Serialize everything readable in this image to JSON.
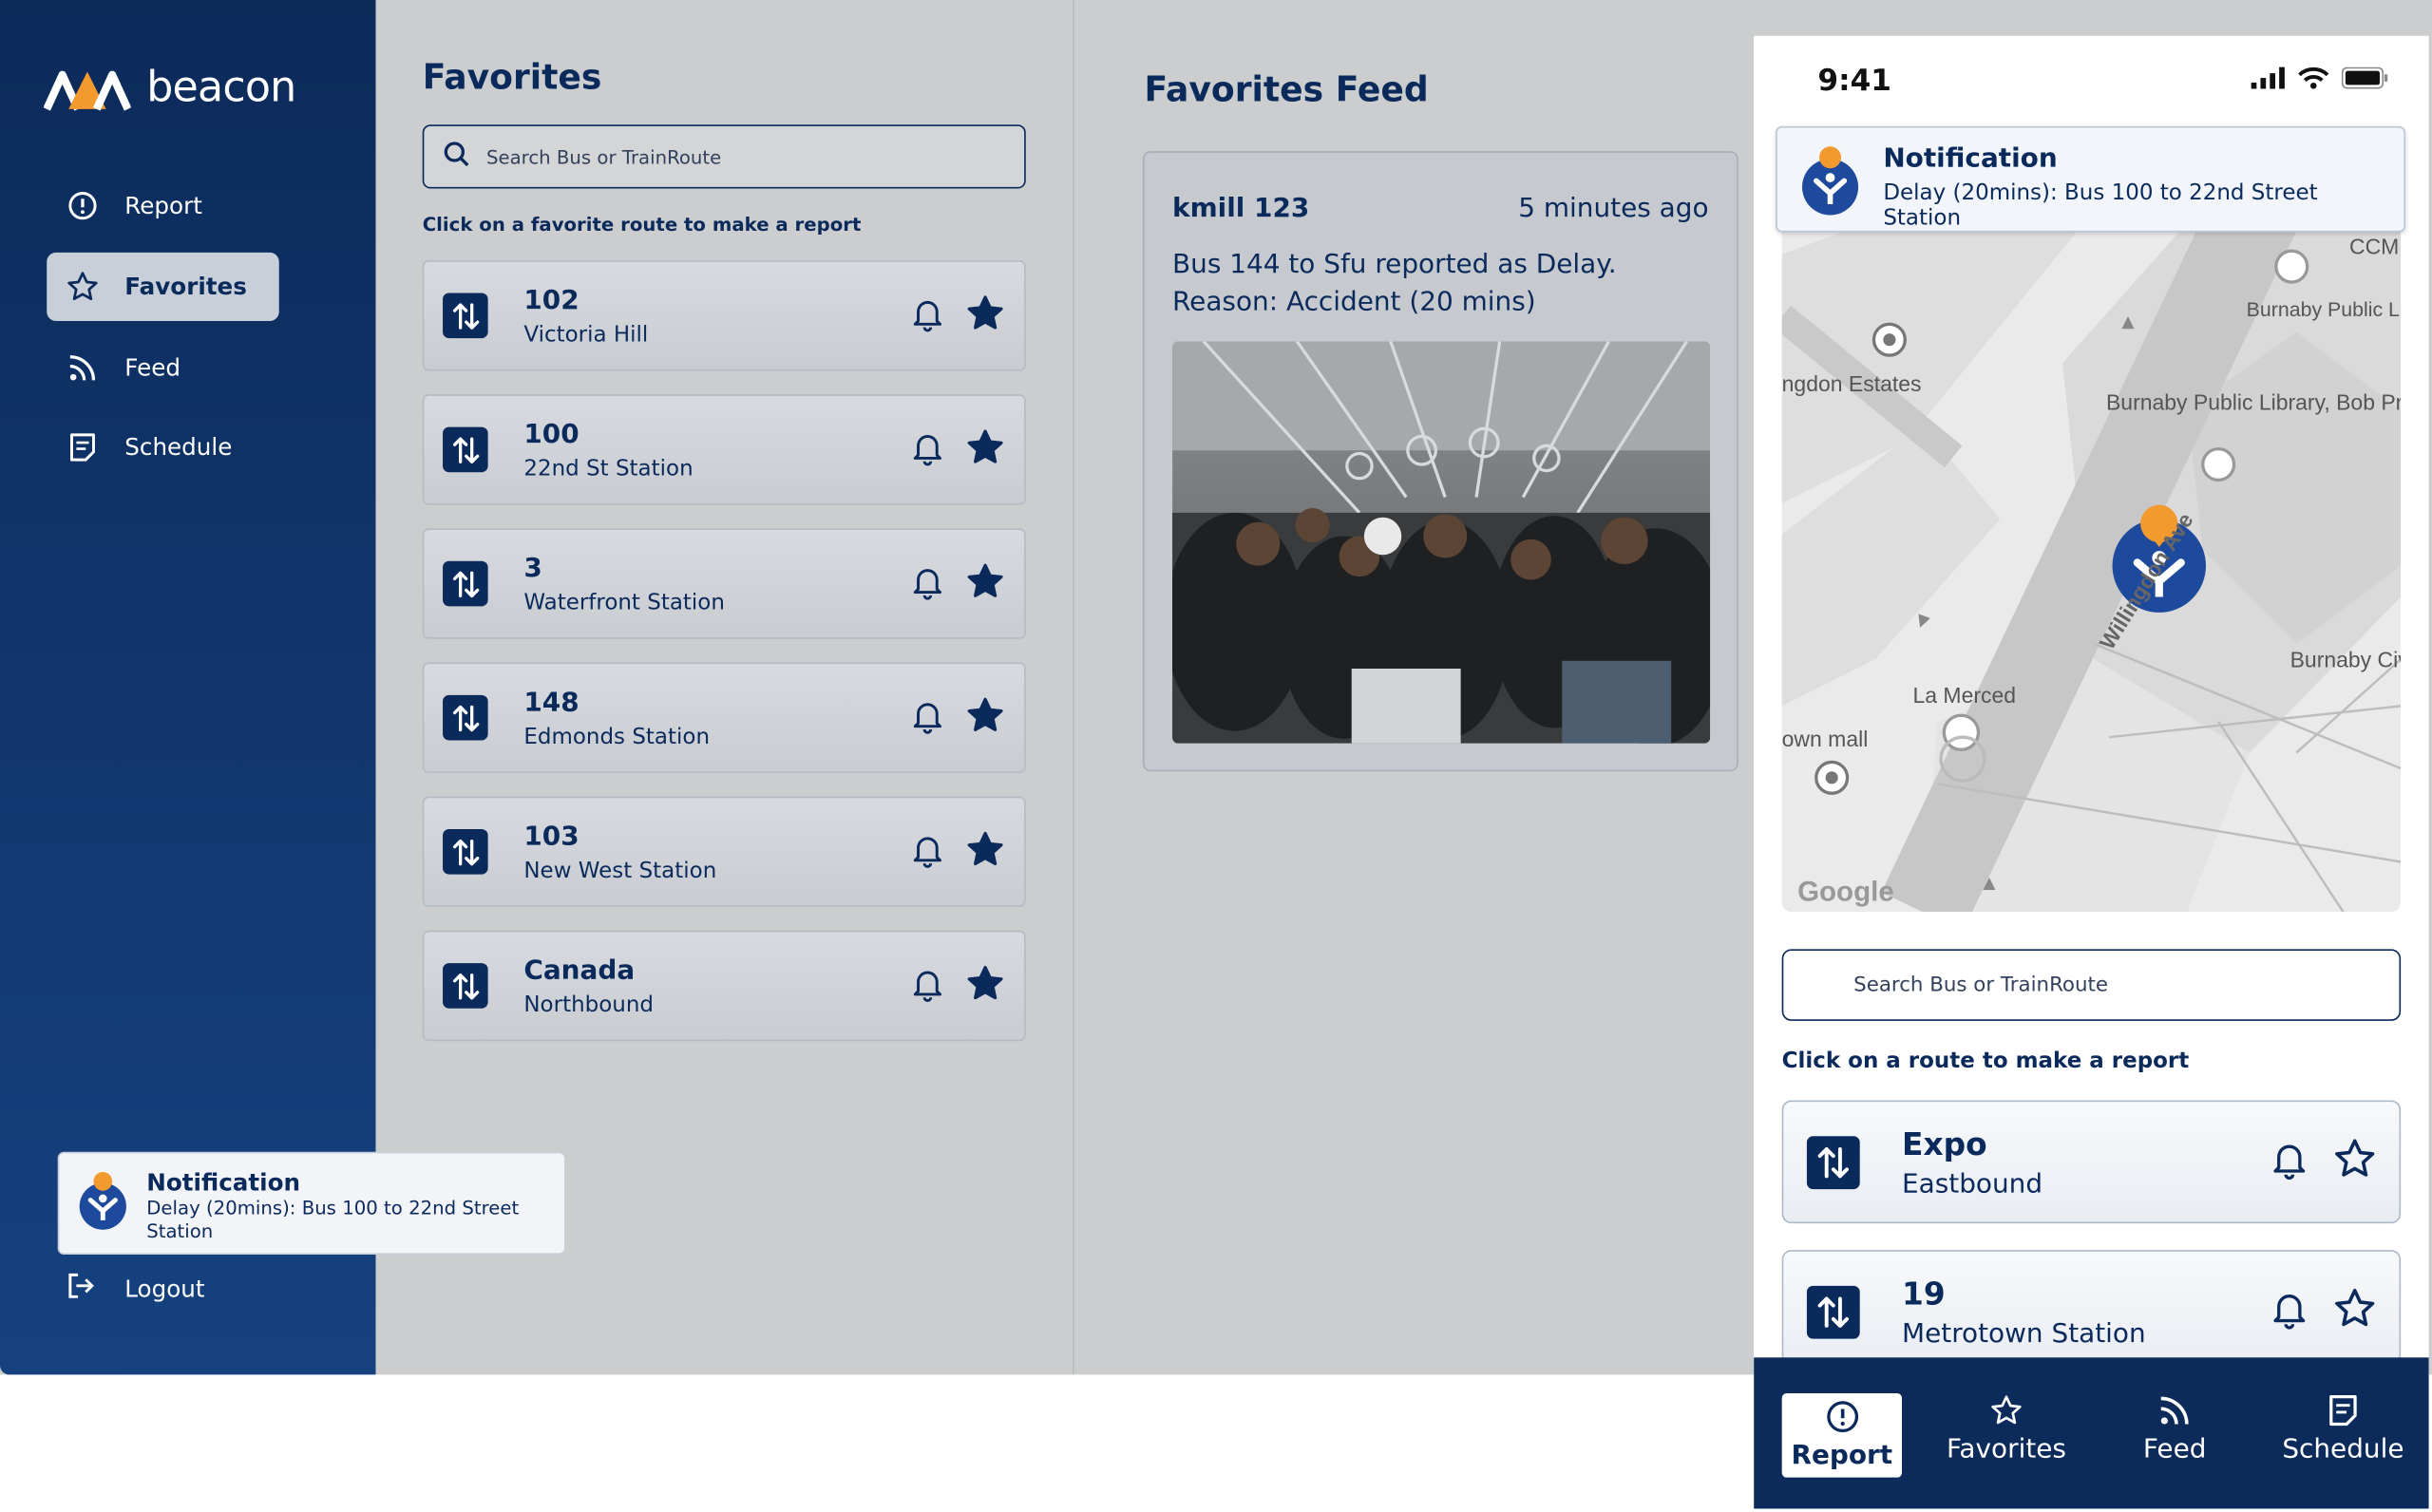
{
  "brand": {
    "name": "beacon"
  },
  "sidebar": {
    "items": [
      {
        "label": "Report",
        "icon": "alert-circle-icon"
      },
      {
        "label": "Favorites",
        "icon": "star-icon"
      },
      {
        "label": "Feed",
        "icon": "rss-icon"
      },
      {
        "label": "Schedule",
        "icon": "schedule-icon"
      }
    ],
    "active": "Favorites",
    "logout": "Logout"
  },
  "toast": {
    "title": "Notification",
    "message": "Delay (20mins): Bus 100 to 22nd Street Station"
  },
  "favorites": {
    "title": "Favorites",
    "search_placeholder": "Search Bus or TrainRoute",
    "hint": "Click on a favorite route to make a report",
    "routes": [
      {
        "number": "102",
        "name": "Victoria Hill"
      },
      {
        "number": "100",
        "name": "22nd St Station"
      },
      {
        "number": "3",
        "name": "Waterfront Station"
      },
      {
        "number": "148",
        "name": "Edmonds Station"
      },
      {
        "number": "103",
        "name": "New West Station"
      },
      {
        "number": "Canada",
        "name": "Northbound"
      }
    ]
  },
  "feed": {
    "title": "Favorites Feed",
    "post": {
      "user": "kmill 123",
      "time": "5 minutes ago",
      "message": "Bus 144 to Sfu reported as Delay. Reason: Accident (20 mins)"
    }
  },
  "phone": {
    "time": "9:41",
    "notification": {
      "title": "Notification",
      "message": "Delay (20mins): Bus 100 to 22nd Street Station"
    },
    "map_labels": {
      "estates": "ngdon Estates",
      "library": "Burnaby Public Library, Bob Prittie...",
      "library_parking": "Burnaby Public Library Parking",
      "street": "Willingdon Ave",
      "la_merced": "La Merced",
      "mall": "own mall",
      "civic": "Burnaby Civic Squa",
      "ccm": "CCM",
      "google": "Google"
    },
    "search_placeholder": "Search Bus or TrainRoute",
    "hint": "Click on a route to make a report",
    "routes": [
      {
        "number": "Expo",
        "name": "Eastbound"
      },
      {
        "number": "19",
        "name": "Metrotown Station"
      }
    ],
    "tabs": [
      {
        "label": "Report",
        "icon": "alert-circle-icon"
      },
      {
        "label": "Favorites",
        "icon": "star-icon"
      },
      {
        "label": "Feed",
        "icon": "rss-icon"
      },
      {
        "label": "Schedule",
        "icon": "schedule-icon"
      }
    ],
    "active_tab": "Report"
  },
  "colors": {
    "navy": "#0c2a5a",
    "accent": "#f29a2e",
    "blue": "#1e4a9e"
  }
}
